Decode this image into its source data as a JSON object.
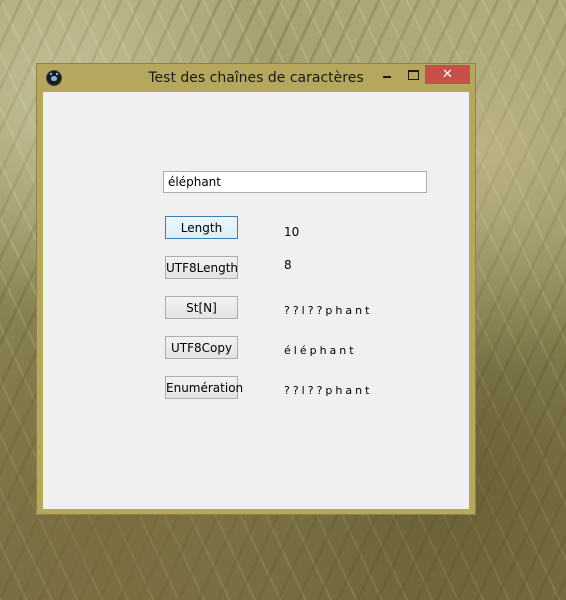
{
  "window": {
    "title": "Test des chaînes de caractères",
    "close_glyph": "✕",
    "icon": "paw-icon"
  },
  "form": {
    "input_value": "éléphant",
    "buttons": {
      "length": "Length",
      "utf8length": "UTF8Length",
      "stn": "St[N]",
      "utf8copy": "UTF8Copy",
      "enumeration": "Enumération"
    },
    "results": {
      "length": "10",
      "utf8length": "8",
      "stn": "??l??phant",
      "utf8copy": "éléphant",
      "enumeration": "??l??phant"
    }
  },
  "colors": {
    "title_bar": "#b5a85e",
    "close_button": "#c7504b",
    "client_area": "#f0f0f0"
  }
}
